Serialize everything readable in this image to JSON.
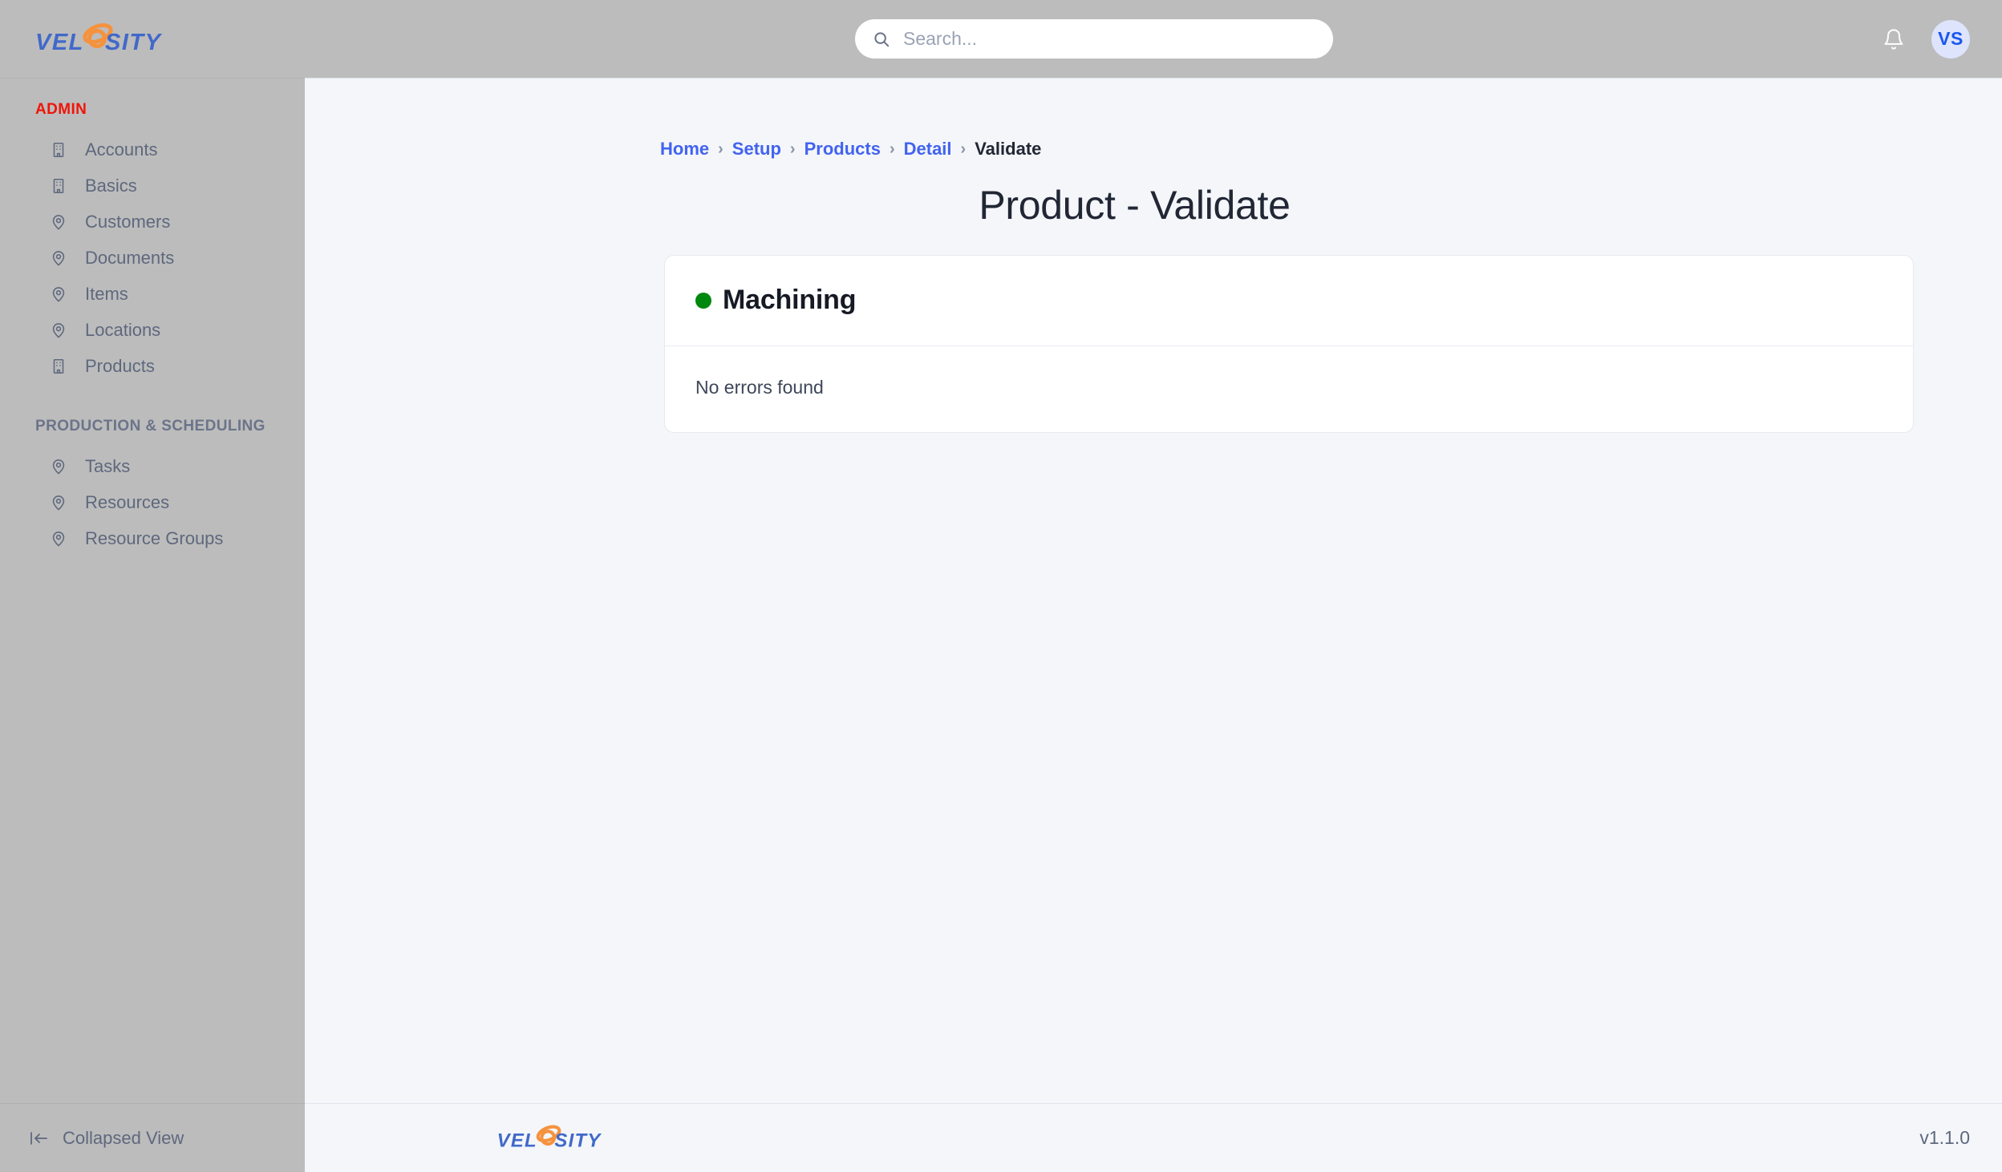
{
  "brand": {
    "logo_text_left": "VEL",
    "logo_text_right": "SITY",
    "logo_name": "velosity-logo",
    "blue": "#4169c9",
    "orange": "#f5923e"
  },
  "topbar": {
    "search": {
      "placeholder": "Search...",
      "value": "",
      "icon": "search-icon"
    },
    "notifications": {
      "icon": "bell-icon",
      "label": ""
    },
    "avatar": {
      "initials": "VS",
      "bg": "#dde4fb",
      "fg": "#1a56f0"
    }
  },
  "sidebar": {
    "sections": [
      {
        "title": "ADMIN",
        "title_color": "#f01408",
        "items": [
          {
            "label": "Accounts",
            "icon": "building-icon"
          },
          {
            "label": "Basics",
            "icon": "building-icon"
          },
          {
            "label": "Customers",
            "icon": "map-pin-icon"
          },
          {
            "label": "Documents",
            "icon": "map-pin-icon"
          },
          {
            "label": "Items",
            "icon": "map-pin-icon"
          },
          {
            "label": "Locations",
            "icon": "map-pin-icon"
          },
          {
            "label": "Products",
            "icon": "building-icon"
          }
        ]
      },
      {
        "title": "PRODUCTION & SCHEDULING",
        "title_color": "#6b7489",
        "items": [
          {
            "label": "Tasks",
            "icon": "map-pin-icon"
          },
          {
            "label": "Resources",
            "icon": "map-pin-icon"
          },
          {
            "label": "Resource Groups",
            "icon": "map-pin-icon"
          }
        ]
      }
    ],
    "footer": {
      "label": "Collapsed View",
      "icon": "collapse-left-icon"
    }
  },
  "breadcrumb": {
    "items": [
      {
        "label": "Home",
        "current": false
      },
      {
        "label": "Setup",
        "current": false
      },
      {
        "label": "Products",
        "current": false
      },
      {
        "label": "Detail",
        "current": false
      },
      {
        "label": "Validate",
        "current": true
      }
    ],
    "separator": "›"
  },
  "page": {
    "title": "Product - Validate"
  },
  "card": {
    "status_color": "#00870d",
    "title": "Machining",
    "body_text": "No errors found"
  },
  "footer": {
    "version": "v1.1.0"
  }
}
